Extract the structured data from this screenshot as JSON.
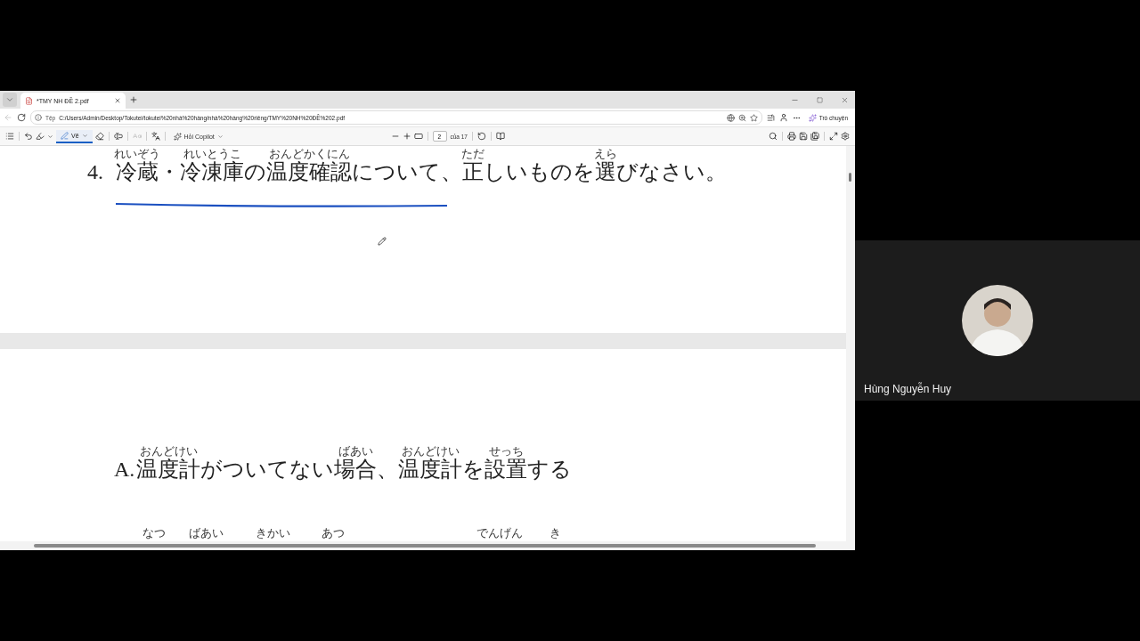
{
  "browser": {
    "tab": {
      "title": "*TMY NH ĐỀ 2.pdf",
      "selected": true
    },
    "address": {
      "scheme_label": "Tệp",
      "url": "C:/Users/Admin/Desktop/Tokutei/tokutei%20nhà%20hàng/nhà%20hàng%20riêng/TMY%20NH%20ĐỀ%202.pdf"
    },
    "chat_button": "Trò chuyện"
  },
  "pdf_toolbar": {
    "draw_button": {
      "label": "Vẽ",
      "selected": true
    },
    "copilot_button": "Hỏi Copilot",
    "page_number": "2",
    "page_count": "của 17"
  },
  "document": {
    "question": {
      "number": "4.",
      "segments": [
        {
          "text": "冷蔵",
          "ruby": "れいぞう"
        },
        {
          "text": "・"
        },
        {
          "text": "冷凍庫",
          "ruby": "れいとうこ"
        },
        {
          "text": "の"
        },
        {
          "text": "温度確認",
          "ruby": "おんどかくにん"
        },
        {
          "text": "について、"
        },
        {
          "text": "正",
          "ruby": "ただ"
        },
        {
          "text": "しいものを"
        },
        {
          "text": "選",
          "ruby": "えら"
        },
        {
          "text": "びなさい。"
        }
      ]
    },
    "options": [
      {
        "label": "A.",
        "segments": [
          {
            "text": "温度計",
            "ruby": "おんどけい"
          },
          {
            "text": "がついてない"
          },
          {
            "text": "場合",
            "ruby": "ばあい"
          },
          {
            "text": "、"
          },
          {
            "text": "温度計",
            "ruby": "おんどけい"
          },
          {
            "text": "を"
          },
          {
            "text": "設置",
            "ruby": "せっち"
          },
          {
            "text": "する"
          }
        ]
      },
      {
        "kind": "partial",
        "furigana": [
          "なつ",
          "ばあい",
          "きかい",
          "あつ",
          "でんげん",
          "き"
        ]
      }
    ]
  },
  "participant": {
    "name": "Hùng Nguyễn Huy"
  }
}
